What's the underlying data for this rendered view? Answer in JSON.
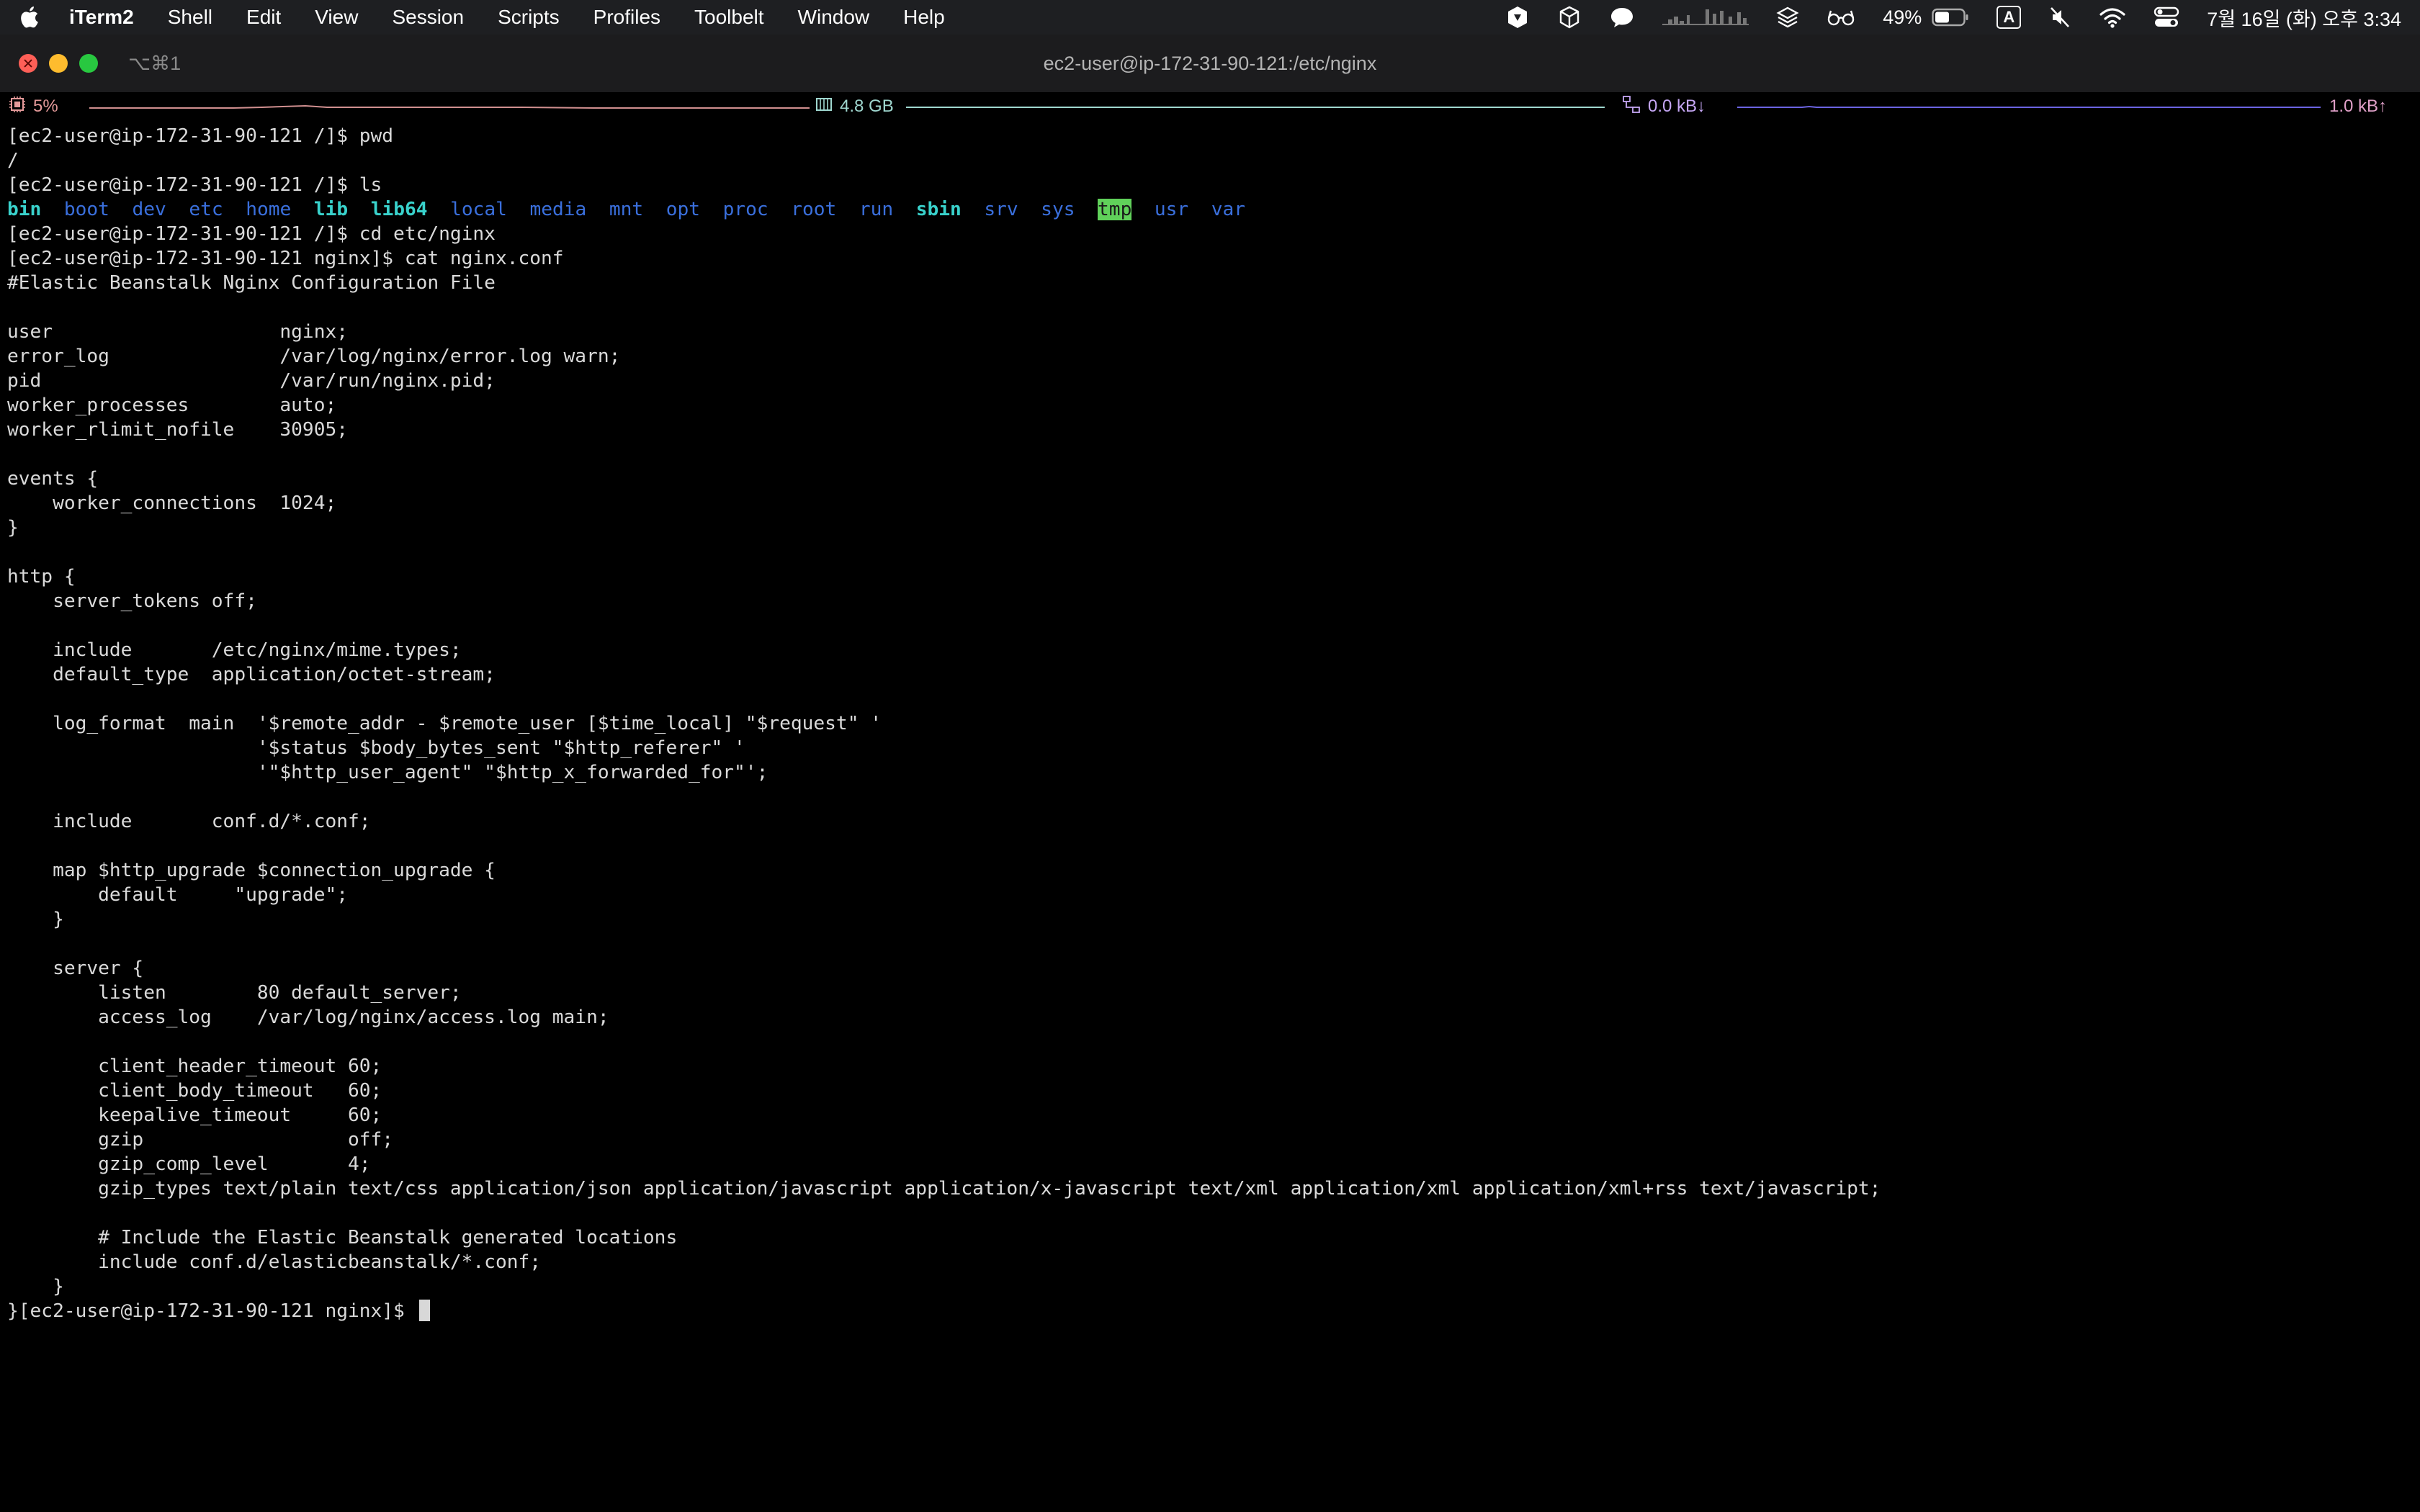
{
  "menubar": {
    "app_name": "iTerm2",
    "items": [
      "Shell",
      "Edit",
      "View",
      "Session",
      "Scripts",
      "Profiles",
      "Toolbelt",
      "Window",
      "Help"
    ],
    "battery_percent": "49%",
    "input_source": "A",
    "datetime": "7월 16일 (화) 오후 3:34"
  },
  "window": {
    "tab_shortcut": "⌥⌘1",
    "title": "ec2-user@ip-172-31-90-121:/etc/nginx"
  },
  "statusbar": {
    "cpu": "5%",
    "memory": "4.8 GB",
    "net_down": "0.0 kB↓",
    "net_up": "1.0 kB↑",
    "colors": {
      "cpu": "#d08f8f",
      "memory": "#9fd7cf",
      "net": "#6b63e0"
    }
  },
  "terminal": {
    "lines": [
      "[ec2-user@ip-172-31-90-121 /]$ pwd",
      "/",
      "[ec2-user@ip-172-31-90-121 /]$ ls",
      "",
      "[ec2-user@ip-172-31-90-121 /]$ cd etc/nginx",
      "[ec2-user@ip-172-31-90-121 nginx]$ cat nginx.conf",
      "#Elastic Beanstalk Nginx Configuration File",
      "",
      "user                    nginx;",
      "error_log               /var/log/nginx/error.log warn;",
      "pid                     /var/run/nginx.pid;",
      "worker_processes        auto;",
      "worker_rlimit_nofile    30905;",
      "",
      "events {",
      "    worker_connections  1024;",
      "}",
      "",
      "http {",
      "    server_tokens off;",
      "",
      "    include       /etc/nginx/mime.types;",
      "    default_type  application/octet-stream;",
      "",
      "    log_format  main  '$remote_addr - $remote_user [$time_local] \"$request\" '",
      "                      '$status $body_bytes_sent \"$http_referer\" '",
      "                      '\"$http_user_agent\" \"$http_x_forwarded_for\"';",
      "",
      "    include       conf.d/*.conf;",
      "",
      "    map $http_upgrade $connection_upgrade {",
      "        default     \"upgrade\";",
      "    }",
      "",
      "    server {",
      "        listen        80 default_server;",
      "        access_log    /var/log/nginx/access.log main;",
      "",
      "        client_header_timeout 60;",
      "        client_body_timeout   60;",
      "        keepalive_timeout     60;",
      "        gzip                  off;",
      "        gzip_comp_level       4;",
      "        gzip_types text/plain text/css application/json application/javascript application/x-javascript text/xml application/xml application/xml+rss text/javascript;",
      "",
      "        # Include the Elastic Beanstalk generated locations",
      "        include conf.d/elasticbeanstalk/*.conf;",
      "    }",
      "}[ec2-user@ip-172-31-90-121 nginx]$ "
    ],
    "ls_output": [
      {
        "name": "bin",
        "color": "cyanb"
      },
      {
        "name": "boot",
        "color": "blue"
      },
      {
        "name": "dev",
        "color": "blue"
      },
      {
        "name": "etc",
        "color": "blue"
      },
      {
        "name": "home",
        "color": "blue"
      },
      {
        "name": "lib",
        "color": "cyanb"
      },
      {
        "name": "lib64",
        "color": "cyanb"
      },
      {
        "name": "local",
        "color": "blue"
      },
      {
        "name": "media",
        "color": "blue"
      },
      {
        "name": "mnt",
        "color": "blue"
      },
      {
        "name": "opt",
        "color": "blue"
      },
      {
        "name": "proc",
        "color": "blue"
      },
      {
        "name": "root",
        "color": "blue"
      },
      {
        "name": "run",
        "color": "blue"
      },
      {
        "name": "sbin",
        "color": "cyanb"
      },
      {
        "name": "srv",
        "color": "blue"
      },
      {
        "name": "sys",
        "color": "blue"
      },
      {
        "name": "tmp",
        "color": "tmp"
      },
      {
        "name": "usr",
        "color": "blue"
      },
      {
        "name": "var",
        "color": "blue"
      }
    ],
    "ls_line_index": 3,
    "cursor_line_index": 48
  }
}
